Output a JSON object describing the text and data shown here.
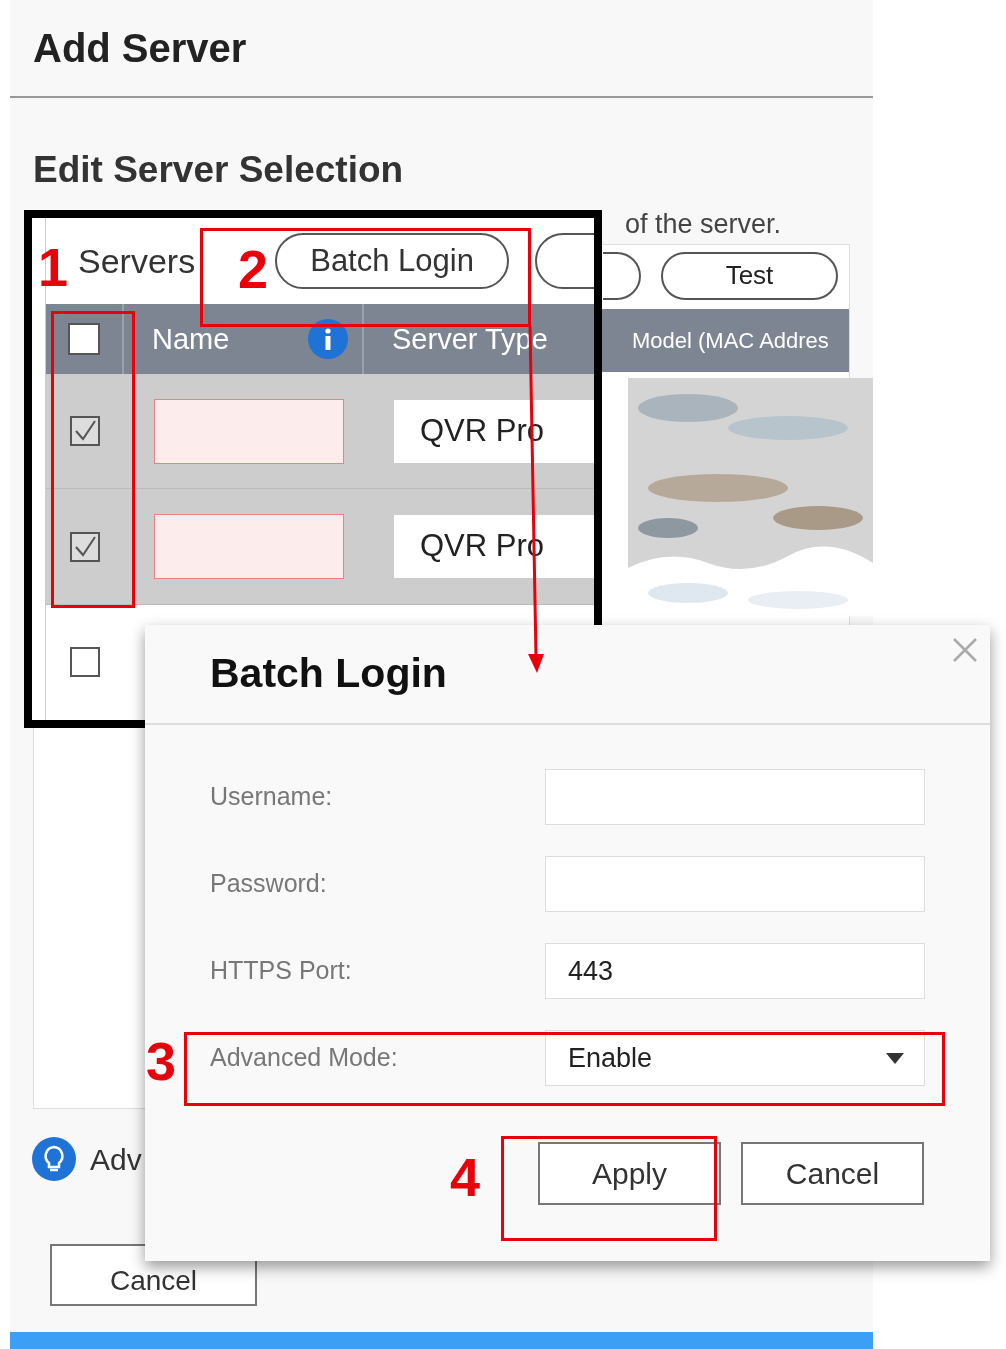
{
  "page": {
    "title": "Add Server",
    "section_title": "Edit Server Selection",
    "description": "of the server."
  },
  "background_table": {
    "test_button": "Test",
    "visible_column": "Model (MAC Addres"
  },
  "inset": {
    "label": "Servers",
    "batch_button": "Batch Login",
    "columns": [
      "Name",
      "Server Type"
    ],
    "header_checked": false,
    "rows": [
      {
        "checked": true,
        "selected": true,
        "server_type": "QVR Pro"
      },
      {
        "checked": true,
        "selected": true,
        "server_type": "QVR Pro"
      },
      {
        "checked": false,
        "selected": false
      }
    ]
  },
  "tip": {
    "text": "Adv"
  },
  "footer_button": "Cancel",
  "dialog": {
    "title": "Batch Login",
    "fields": [
      {
        "label": "Username:",
        "kind": "text"
      },
      {
        "label": "Password:",
        "kind": "text"
      },
      {
        "label": "HTTPS Port:",
        "kind": "text",
        "value": "443"
      },
      {
        "label": "Advanced Mode:",
        "kind": "select",
        "value": "Enable"
      }
    ],
    "buttons": [
      "Apply",
      "Cancel"
    ]
  },
  "annotations": [
    {
      "number": "1"
    },
    {
      "number": "2"
    },
    {
      "number": "3"
    },
    {
      "number": "4"
    }
  ]
}
